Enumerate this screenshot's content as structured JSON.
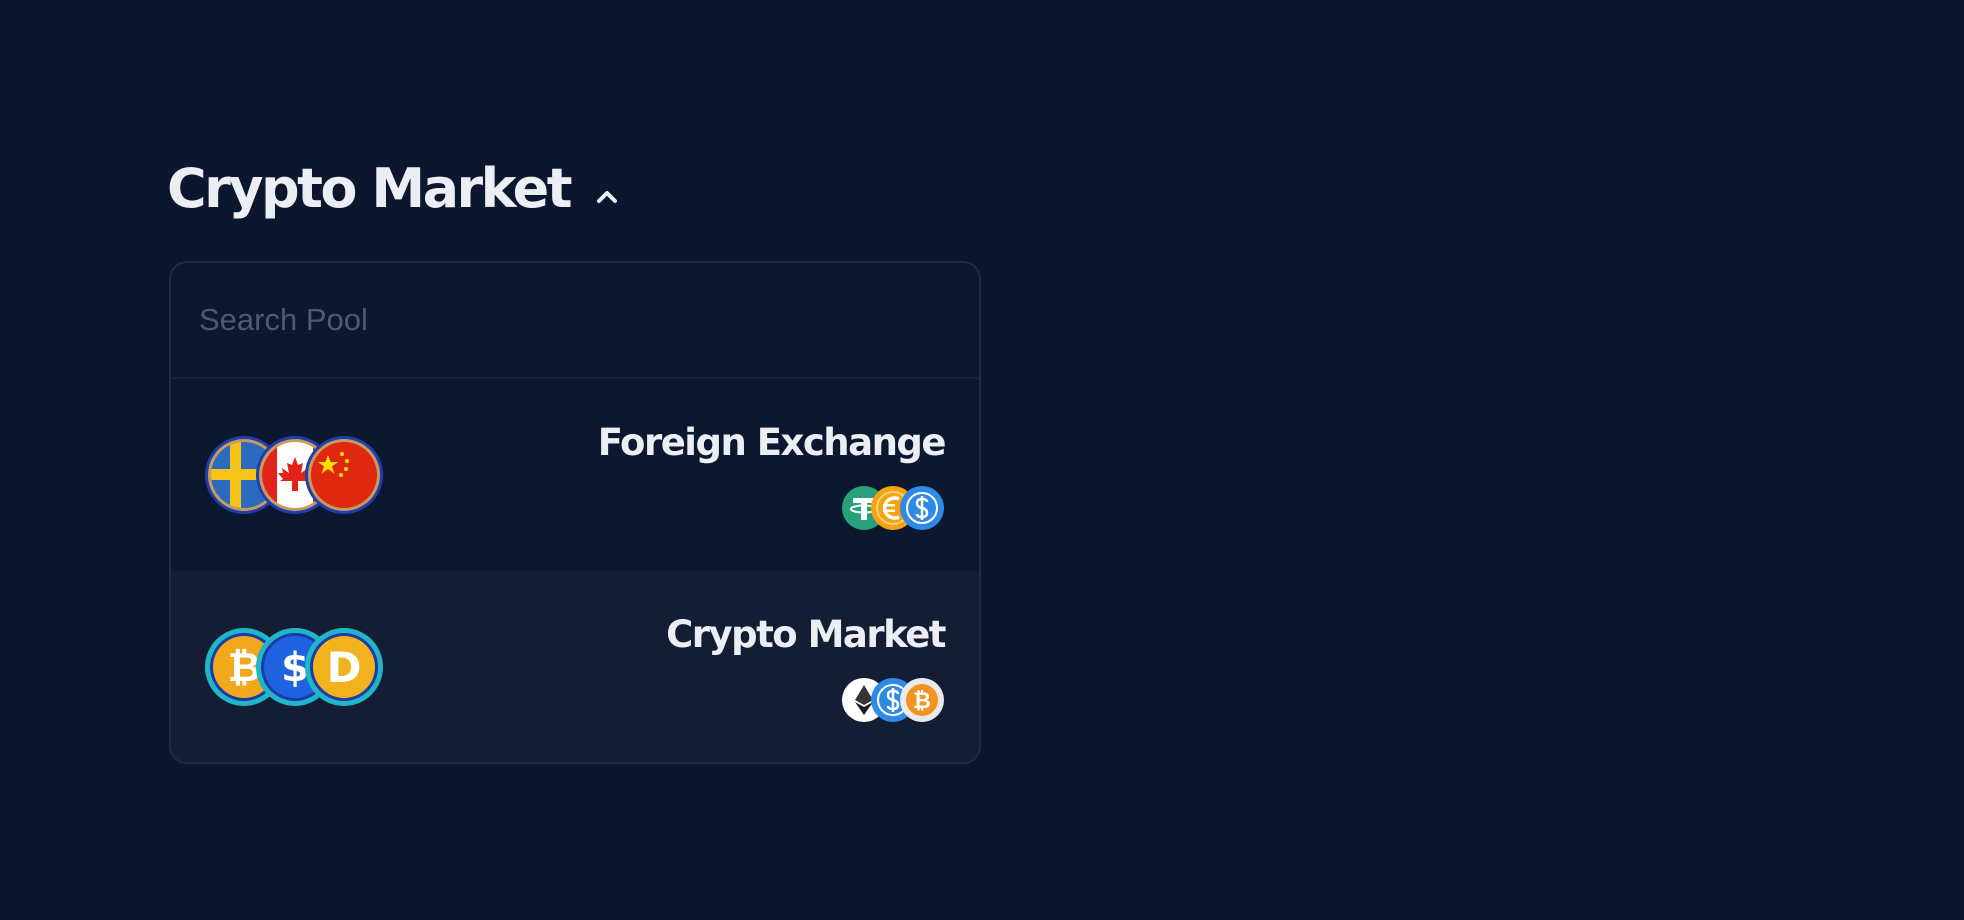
{
  "header": {
    "title": "Crypto Market"
  },
  "search": {
    "placeholder": "Search Pool",
    "value": ""
  },
  "pools": [
    {
      "name": "Foreign Exchange",
      "main_icons": [
        "sweden-flag",
        "canada-flag",
        "china-flag"
      ],
      "token_icons": [
        "tether-icon",
        "euro-coin-icon",
        "usd-coin-icon"
      ]
    },
    {
      "name": "Crypto Market",
      "main_icons": [
        "bitcoin-icon",
        "dollar-coin-icon",
        "dogecoin-icon"
      ],
      "token_icons": [
        "ethereum-icon",
        "usd-coin-icon",
        "bitcoin-icon"
      ],
      "selected": true
    }
  ],
  "colors": {
    "background": "#0b172e",
    "panel": "#0c1730",
    "row_selected": "#131e35",
    "border": "#1e2b42",
    "text": "#eceef3",
    "placeholder": "#4d5a70"
  }
}
